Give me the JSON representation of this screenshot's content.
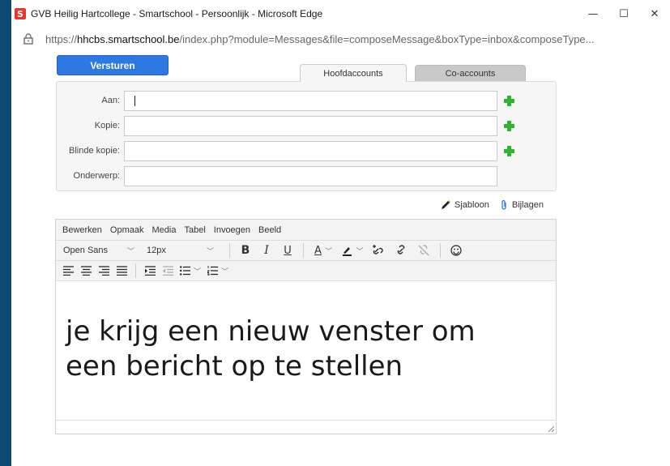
{
  "window": {
    "title": "GVB Heilig Hartcollege - Smartschool - Persoonlijk - Microsoft Edge",
    "logo_letter": "S",
    "minimize": "—",
    "maximize": "☐",
    "close": "✕"
  },
  "address": {
    "scheme": "https://",
    "host": "hhcbs.smartschool.be",
    "path": "/index.php?module=Messages&file=composeMessage&boxType=inbox&composeType..."
  },
  "compose": {
    "send_label": "Versturen",
    "tabs": [
      "Hoofdaccounts",
      "Co-accounts"
    ],
    "fields": {
      "to_label": "Aan:",
      "cc_label": "Kopie:",
      "bcc_label": "Blinde kopie:",
      "subject_label": "Onderwerp:"
    },
    "template_label": "Sjabloon",
    "attachments_label": "Bijlagen"
  },
  "editor": {
    "menu": [
      "Bewerken",
      "Opmaak",
      "Media",
      "Tabel",
      "Invoegen",
      "Beeld"
    ],
    "font_family": "Open Sans",
    "font_size": "12px",
    "bold": "B",
    "italic": "I",
    "underline": "U",
    "text_color": "A",
    "body_line1": "je krijg een nieuw venster om",
    "body_line2": "een bericht op te stellen"
  },
  "colors": {
    "background": "#0c4a72",
    "send_button": "#2e78e1",
    "add_icon": "#2db52b",
    "logo": "#e8362a"
  }
}
